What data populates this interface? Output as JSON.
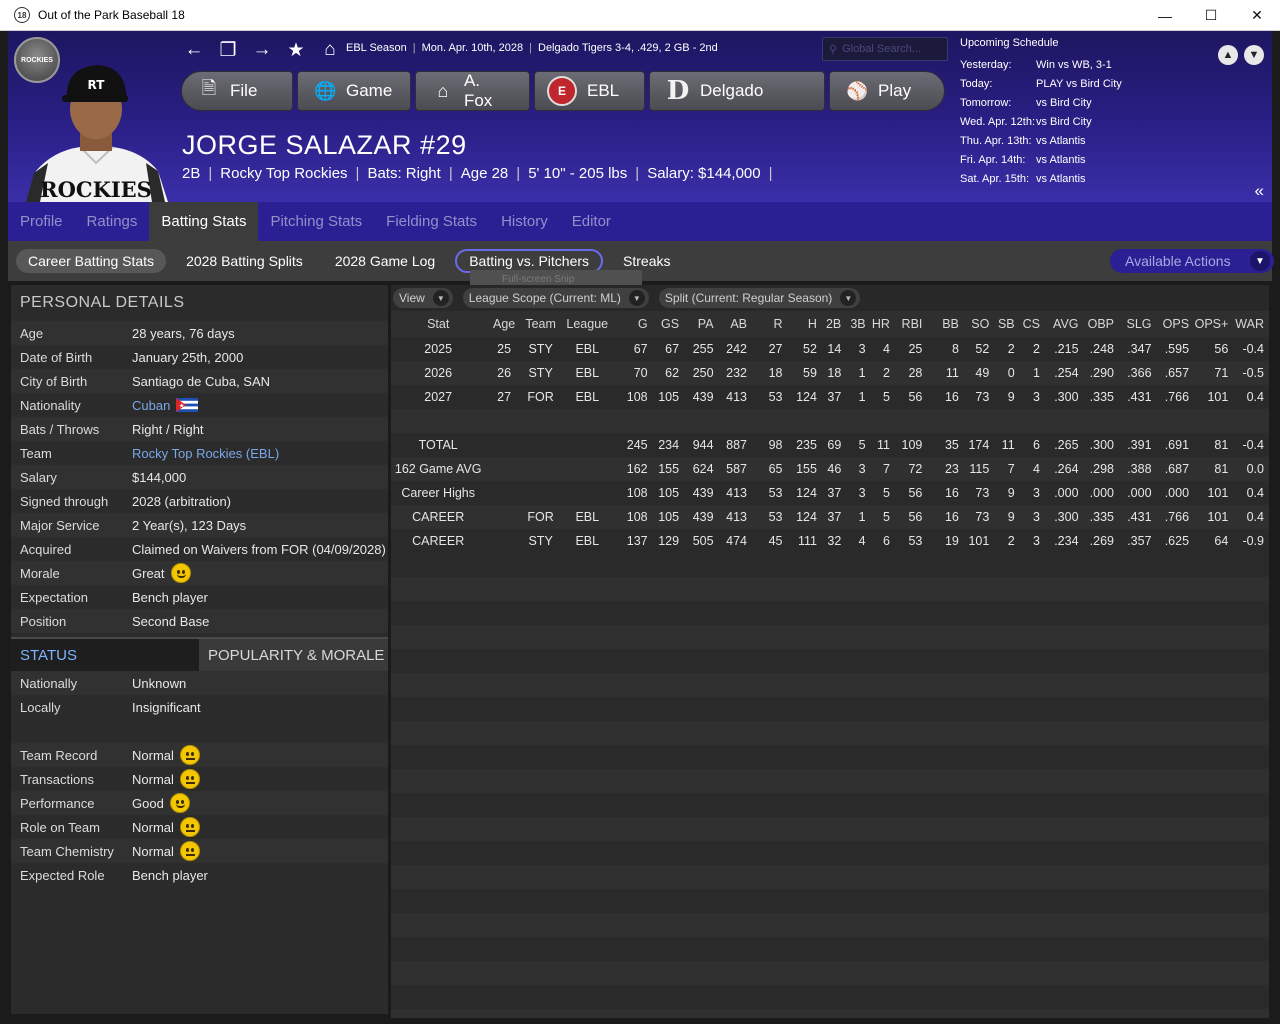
{
  "window": {
    "title": "Out of the Park Baseball 18",
    "app_icon_text": "18"
  },
  "header": {
    "season_info": [
      "EBL Season",
      "Mon. Apr. 10th, 2028",
      "Delgado Tigers  3-4, .429, 2 GB - 2nd"
    ],
    "search_placeholder": "Global Search...",
    "menu": [
      {
        "label": "File",
        "icon": "file-icon"
      },
      {
        "label": "Game",
        "icon": "globe-icon"
      },
      {
        "label": "A. Fox",
        "icon": "home-icon"
      },
      {
        "label": "EBL",
        "icon": "ebl-logo-icon"
      },
      {
        "label": "Delgado",
        "icon": "tigers-logo-icon"
      },
      {
        "label": "Play",
        "icon": "baseball-icon"
      }
    ],
    "player_name": "JORGE SALAZAR  #29",
    "player_sub": [
      "2B",
      "Rocky Top Rockies",
      "Bats: Right",
      "Age 28",
      "5' 10\" - 205 lbs",
      "Salary: $144,000"
    ],
    "jersey_text": "ROCKIES"
  },
  "schedule": {
    "title": "Upcoming Schedule",
    "rows": [
      {
        "day": "Yesterday:",
        "game": "Win vs WB, 3-1"
      },
      {
        "day": "Today:",
        "game": "PLAY vs Bird City"
      },
      {
        "day": "Tomorrow:",
        "game": "vs Bird City"
      },
      {
        "day": "Wed. Apr. 12th:",
        "game": "vs Bird City"
      },
      {
        "day": "Thu. Apr. 13th:",
        "game": "vs Atlantis"
      },
      {
        "day": "Fri. Apr. 14th:",
        "game": "vs Atlantis"
      },
      {
        "day": "Sat. Apr. 15th:",
        "game": "vs Atlantis"
      }
    ]
  },
  "tabs": [
    "Profile",
    "Ratings",
    "Batting Stats",
    "Pitching Stats",
    "Fielding Stats",
    "History",
    "Editor"
  ],
  "active_tab": "Batting Stats",
  "subtabs": [
    "Career Batting Stats",
    "2028 Batting Splits",
    "2028 Game Log",
    "Batting vs. Pitchers",
    "Streaks"
  ],
  "tooltip_ghost": "Full-screen Snip",
  "available_actions": "Available Actions",
  "personal_details": {
    "title": "PERSONAL DETAILS",
    "rows": [
      {
        "k": "Age",
        "v": "28 years, 76 days"
      },
      {
        "k": "Date of Birth",
        "v": "January 25th, 2000"
      },
      {
        "k": "City of Birth",
        "v": "Santiago de Cuba, SAN"
      },
      {
        "k": "Nationality",
        "v": "Cuban"
      },
      {
        "k": "Bats / Throws",
        "v": "Right / Right"
      },
      {
        "k": "Team",
        "v": "Rocky Top Rockies (EBL)"
      },
      {
        "k": "Salary",
        "v": "$144,000"
      },
      {
        "k": "Signed through",
        "v": "2028 (arbitration)"
      },
      {
        "k": "Major Service",
        "v": "2 Year(s), 123 Days"
      },
      {
        "k": "Acquired",
        "v": "Claimed on Waivers from FOR (04/09/2028)"
      },
      {
        "k": "Morale",
        "v": "Great"
      },
      {
        "k": "Expectation",
        "v": "Bench player"
      },
      {
        "k": "Position",
        "v": "Second Base"
      }
    ]
  },
  "status": {
    "tab1": "STATUS",
    "tab2": "POPULARITY & MORALE",
    "rows1": [
      {
        "k": "Nationally",
        "v": "Unknown"
      },
      {
        "k": "Locally",
        "v": "Insignificant"
      }
    ],
    "rows2": [
      {
        "k": "Team Record",
        "v": "Normal"
      },
      {
        "k": "Transactions",
        "v": "Normal"
      },
      {
        "k": "Performance",
        "v": "Good"
      },
      {
        "k": "Role on Team",
        "v": "Normal"
      },
      {
        "k": "Team Chemistry",
        "v": "Normal"
      },
      {
        "k": "Expected Role",
        "v": "Bench player"
      }
    ]
  },
  "filters": [
    "View",
    "League Scope  (Current: ML)",
    "Split  (Current: Regular Season)"
  ],
  "stats_table": {
    "columns": [
      "Stat",
      "Age",
      "Team",
      "League",
      "G",
      "GS",
      "PA",
      "AB",
      "R",
      "H",
      "2B",
      "3B",
      "HR",
      "RBI",
      "BB",
      "SO",
      "SB",
      "CS",
      "AVG",
      "OBP",
      "SLG",
      "OPS",
      "OPS+",
      "WAR"
    ],
    "rows": [
      [
        "2025",
        "25",
        "STY",
        "EBL",
        "67",
        "67",
        "255",
        "242",
        "27",
        "52",
        "14",
        "3",
        "4",
        "25",
        "8",
        "52",
        "2",
        "2",
        ".215",
        ".248",
        ".347",
        ".595",
        "56",
        "-0.4"
      ],
      [
        "2026",
        "26",
        "STY",
        "EBL",
        "70",
        "62",
        "250",
        "232",
        "18",
        "59",
        "18",
        "1",
        "2",
        "28",
        "11",
        "49",
        "0",
        "1",
        ".254",
        ".290",
        ".366",
        ".657",
        "71",
        "-0.5"
      ],
      [
        "2027",
        "27",
        "FOR",
        "EBL",
        "108",
        "105",
        "439",
        "413",
        "53",
        "124",
        "37",
        "1",
        "5",
        "56",
        "16",
        "73",
        "9",
        "3",
        ".300",
        ".335",
        ".431",
        ".766",
        "101",
        "0.4"
      ],
      [
        "",
        "",
        "",
        "",
        "",
        "",
        "",
        "",
        "",
        "",
        "",
        "",
        "",
        "",
        "",
        "",
        "",
        "",
        "",
        "",
        "",
        "",
        "",
        ""
      ],
      [
        "TOTAL",
        "",
        "",
        "",
        "245",
        "234",
        "944",
        "887",
        "98",
        "235",
        "69",
        "5",
        "11",
        "109",
        "35",
        "174",
        "11",
        "6",
        ".265",
        ".300",
        ".391",
        ".691",
        "81",
        "-0.4"
      ],
      [
        "162 Game AVG",
        "",
        "",
        "",
        "162",
        "155",
        "624",
        "587",
        "65",
        "155",
        "46",
        "3",
        "7",
        "72",
        "23",
        "115",
        "7",
        "4",
        ".264",
        ".298",
        ".388",
        ".687",
        "81",
        "0.0"
      ],
      [
        "Career Highs",
        "",
        "",
        "",
        "108",
        "105",
        "439",
        "413",
        "53",
        "124",
        "37",
        "3",
        "5",
        "56",
        "16",
        "73",
        "9",
        "3",
        ".000",
        ".000",
        ".000",
        ".000",
        "101",
        "0.4"
      ],
      [
        "CAREER",
        "",
        "FOR",
        "EBL",
        "108",
        "105",
        "439",
        "413",
        "53",
        "124",
        "37",
        "1",
        "5",
        "56",
        "16",
        "73",
        "9",
        "3",
        ".300",
        ".335",
        ".431",
        ".766",
        "101",
        "0.4"
      ],
      [
        "CAREER",
        "",
        "STY",
        "EBL",
        "137",
        "129",
        "505",
        "474",
        "45",
        "111",
        "32",
        "4",
        "6",
        "53",
        "19",
        "101",
        "2",
        "3",
        ".234",
        ".269",
        ".357",
        ".625",
        "64",
        "-0.9"
      ]
    ]
  }
}
